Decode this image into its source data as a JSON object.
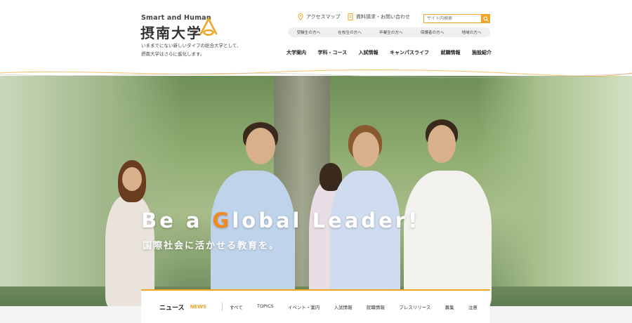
{
  "header": {
    "logo_en": "Smart and Human",
    "logo_jp": "摂南大学",
    "tagline_1": "いままでにない新しいタイプの総合大学として、",
    "tagline_2": "摂南大学はさらに進化します。",
    "access_map": "アクセスマップ",
    "request": "資料請求・お問い合わせ",
    "search_placeholder": "サイト内検索",
    "targets": [
      "受験生の方へ",
      "在校生の方へ",
      "卒業生の方へ",
      "保護者の方へ",
      "地域の方へ"
    ],
    "nav": [
      "大学案内",
      "学科・コース",
      "入試情報",
      "キャンパスライフ",
      "就職情報",
      "施設紹介"
    ]
  },
  "hero": {
    "headline_pre": "Be a ",
    "headline_g": "G",
    "headline_post": "lobal Leader!",
    "subline": "国際社会に活かせる教育を。"
  },
  "news": {
    "title": "ニュース",
    "title_en": "NEWS",
    "categories": [
      "すべて",
      "TOPICS",
      "イベント・案内",
      "入試情報",
      "就職情報",
      "プレスリリース",
      "募集",
      "注意"
    ]
  },
  "colors": {
    "accent": "#f1a526",
    "headline_g": "#f08a1e"
  }
}
